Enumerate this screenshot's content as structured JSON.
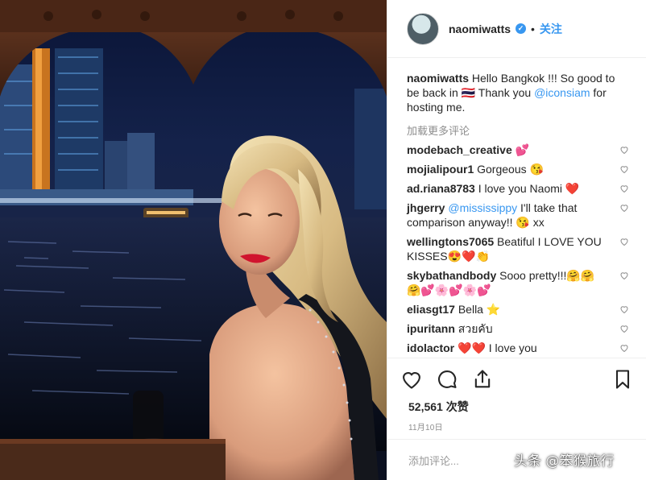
{
  "post": {
    "username": "naomiwatts",
    "verified": true,
    "separator": "•",
    "follow_label": "关注",
    "caption_username": "naomiwatts",
    "caption_text_1": "Hello Bangkok !!! So good to be back in",
    "caption_flag": "🇹🇭",
    "caption_text_2": "Thank you",
    "caption_mention": "@iconsiam",
    "caption_text_3": "for hosting me.",
    "load_more_label": "加载更多评论"
  },
  "comments": [
    {
      "user": "modebach_creative",
      "text": "💕"
    },
    {
      "user": "mojialipour1",
      "text": "Gorgeous 😘"
    },
    {
      "user": "ad.riana8783",
      "text": "I love you Naomi ❤️"
    },
    {
      "user": "jhgerry",
      "mention": "@mississippy",
      "text": "I'll take that comparison anyway!! 😘 xx"
    },
    {
      "user": "wellingtons7065",
      "text": "Beatiful I LOVE YOU KISSES😍❤️👏"
    },
    {
      "user": "skybathandbody",
      "text": "Sooo pretty!!!🤗🤗🤗💕🌸💕🌸💕"
    },
    {
      "user": "eliasgt17",
      "text": "Bella ⭐"
    },
    {
      "user": "ipuritann",
      "text": "สวยคับ"
    },
    {
      "user": "idolactor",
      "text": "❤️❤️ I love you"
    }
  ],
  "actions": {
    "like_icon": "heart-icon",
    "comment_icon": "comment-bubble-icon",
    "share_icon": "share-icon",
    "save_icon": "bookmark-icon"
  },
  "likes_label": "52,561 次赞",
  "date_label": "11月10日",
  "add_comment_placeholder": "添加评论...",
  "watermark": "头条 @笨猴旅行",
  "colors": {
    "link": "#3897f0",
    "text": "#262626",
    "muted": "#8e8e8e",
    "lipstick": "#d0142e"
  }
}
